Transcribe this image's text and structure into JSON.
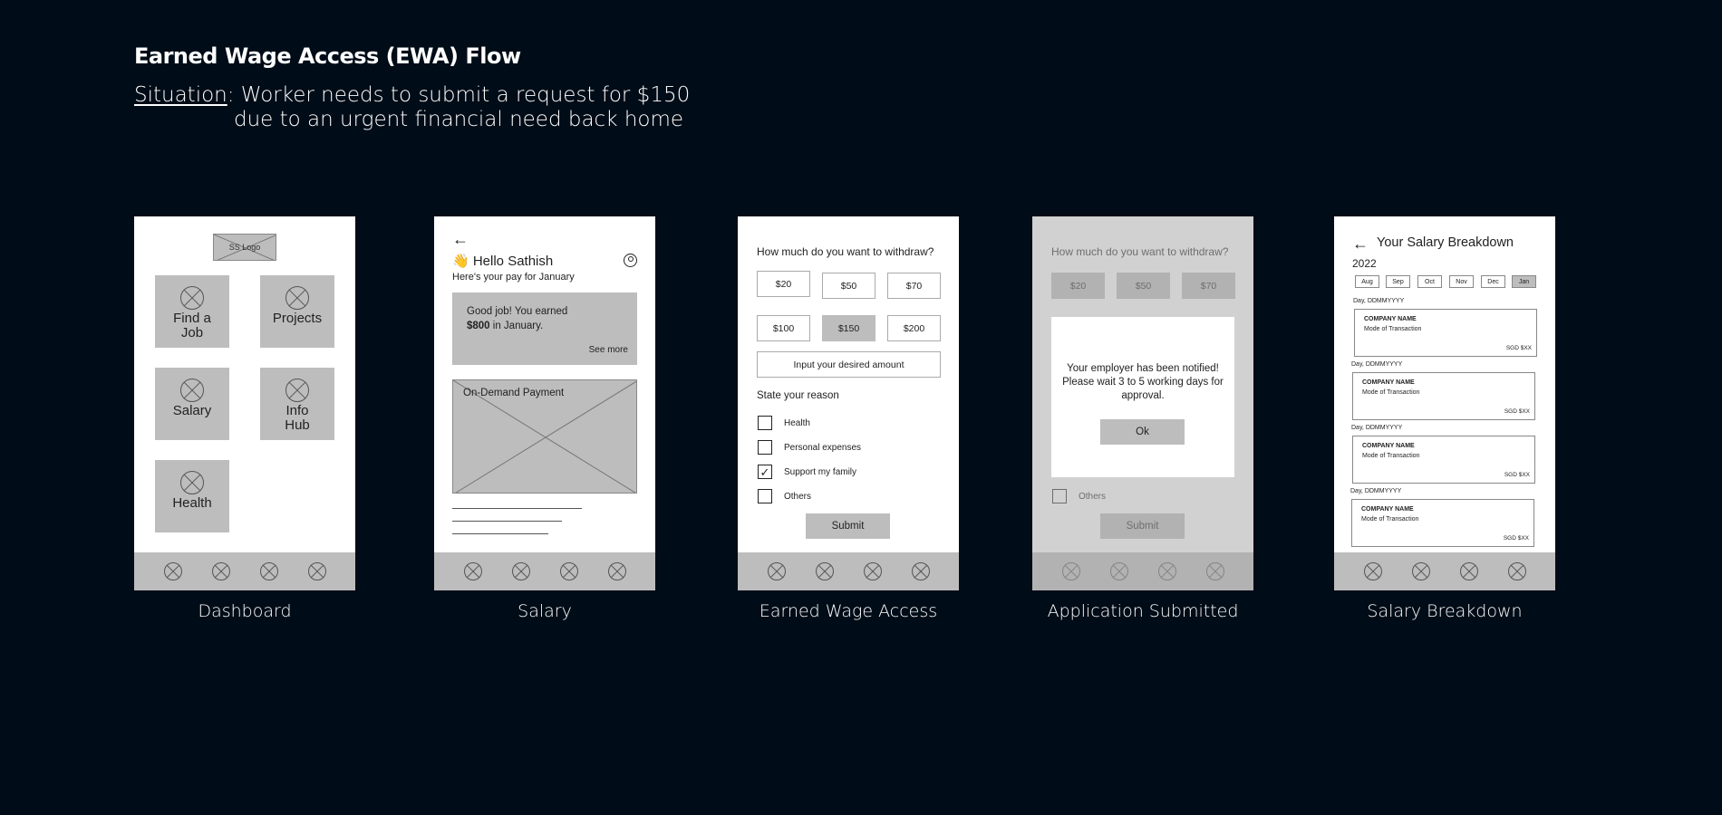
{
  "header": {
    "title": "Earned Wage Access (EWA) Flow",
    "situation_label": "Situation",
    "situation_line1": ": Worker needs to submit a request for $150",
    "situation_line2": "due to an urgent financial need back home"
  },
  "captions": {
    "dashboard": "Dashboard",
    "salary": "Salary",
    "ewa": "Earned Wage Access",
    "submitted": "Application Submitted",
    "breakdown": "Salary Breakdown"
  },
  "dashboard": {
    "logo": "SS Logo",
    "tiles": [
      "Find a Job",
      "Projects",
      "Salary",
      "Info Hub",
      "Health"
    ]
  },
  "salary": {
    "greeting": "👋 Hello Sathish",
    "subtitle": "Here's your pay for January",
    "card_line1": "Good job! You earned",
    "card_amount": "$800",
    "card_line2_rest": " in January.",
    "see_more": "See more",
    "ondemand": "On-Demand Payment"
  },
  "ewa": {
    "question": "How much do you want to withdraw?",
    "amounts": [
      "$20",
      "$50",
      "$70",
      "$100",
      "$150",
      "$200"
    ],
    "selected_amount": "$150",
    "desired_placeholder": "Input your desired amount",
    "reason_title": "State your reason",
    "reasons": [
      "Health",
      "Personal expenses",
      "Support my family",
      "Others"
    ],
    "checked_reason": "Support my family",
    "submit": "Submit"
  },
  "submitted": {
    "message": "Your employer has been notified! Please wait 3 to 5 working days for approval.",
    "ok": "Ok",
    "visible_other": "Others"
  },
  "breakdown": {
    "title": "Your Salary Breakdown",
    "year": "2022",
    "months": [
      "Aug",
      "Sep",
      "Oct",
      "Nov",
      "Dec",
      "Jan"
    ],
    "selected_month": "Jan",
    "transactions": [
      {
        "date": "Day, DDMMYYYY",
        "company": "COMPANY NAME",
        "mode": "Mode of Transaction",
        "amount": "SGD $XX"
      },
      {
        "date": "Day, DDMMYYYY",
        "company": "COMPANY NAME",
        "mode": "Mode of Transaction",
        "amount": "SGD $XX"
      },
      {
        "date": "Day, DDMMYYYY",
        "company": "COMPANY NAME",
        "mode": "Mode of Transaction",
        "amount": "SGD $XX"
      },
      {
        "date": "Day, DDMMYYYY",
        "company": "COMPANY NAME",
        "mode": "Mode of Transaction",
        "amount": "SGD $XX"
      }
    ]
  },
  "colors": {
    "background": "#000c17",
    "placeholder_gray": "#bdbdbd"
  }
}
